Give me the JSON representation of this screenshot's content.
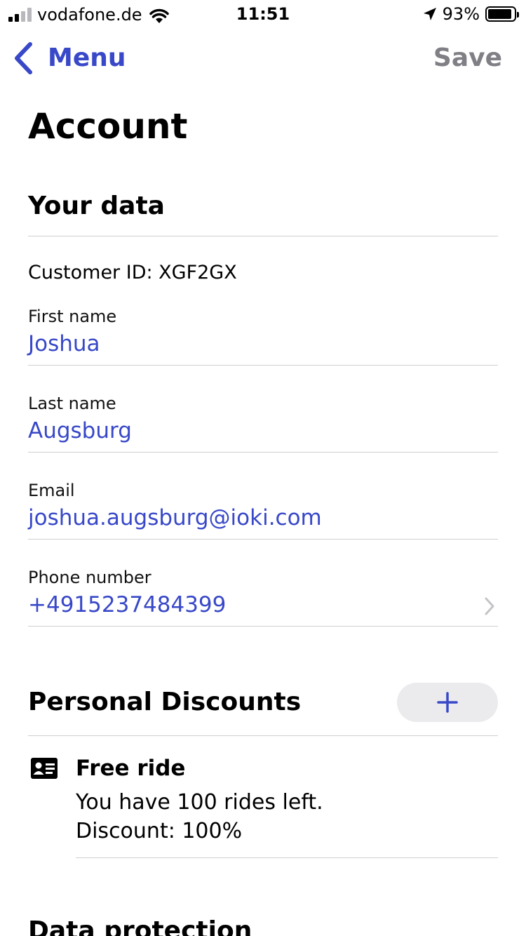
{
  "status_bar": {
    "carrier": "vodafone.de",
    "time": "11:51",
    "battery_percent": "93%",
    "battery_level": 0.93,
    "signal_bars_active": 2
  },
  "nav": {
    "back_label": "Menu",
    "save_label": "Save"
  },
  "page_title": "Account",
  "your_data": {
    "title": "Your data",
    "customer_id": "Customer ID: XGF2GX",
    "fields": [
      {
        "label": "First name",
        "value": "Joshua"
      },
      {
        "label": "Last name",
        "value": "Augsburg"
      },
      {
        "label": "Email",
        "value": "joshua.augsburg@ioki.com"
      },
      {
        "label": "Phone number",
        "value": "+4915237484399"
      }
    ]
  },
  "personal_discounts": {
    "title": "Personal Discounts",
    "items": [
      {
        "icon": "id-card-icon",
        "title": "Free ride",
        "line1": "You have 100 rides left.",
        "line2": "Discount: 100%"
      }
    ]
  },
  "data_protection": {
    "title": "Data protection"
  },
  "colors": {
    "accent": "#3848c8",
    "disabled": "#7f7f85",
    "divider": "#cfcfd3",
    "button_bg": "#ebebee"
  }
}
